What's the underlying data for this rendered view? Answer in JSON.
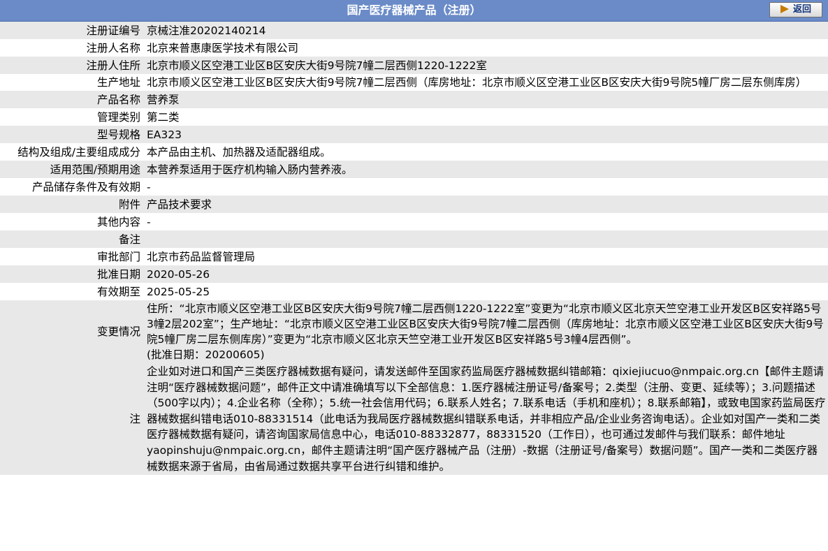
{
  "header": {
    "title": "国产医疗器械产品（注册）",
    "back_label": "返回"
  },
  "rows": [
    {
      "label": "注册证编号",
      "value": "京械注准20202140214"
    },
    {
      "label": "注册人名称",
      "value": "北京来普惠康医学技术有限公司"
    },
    {
      "label": "注册人住所",
      "value": "北京市顺义区空港工业区B区安庆大街9号院7幢二层西侧1220-1222室"
    },
    {
      "label": "生产地址",
      "value": "北京市顺义区空港工业区B区安庆大街9号院7幢二层西侧（库房地址：北京市顺义区空港工业区B区安庆大街9号院5幢厂房二层东侧库房）"
    },
    {
      "label": "产品名称",
      "value": "营养泵"
    },
    {
      "label": "管理类别",
      "value": "第二类"
    },
    {
      "label": "型号规格",
      "value": "EA323"
    },
    {
      "label": "结构及组成/主要组成成分",
      "value": "本产品由主机、加热器及适配器组成。"
    },
    {
      "label": "适用范围/预期用途",
      "value": "本营养泵适用于医疗机构输入肠内营养液。"
    },
    {
      "label": "产品储存条件及有效期",
      "value": "-"
    },
    {
      "label": "附件",
      "value": "产品技术要求"
    },
    {
      "label": "其他内容",
      "value": "-"
    },
    {
      "label": "备注",
      "value": ""
    },
    {
      "label": "审批部门",
      "value": "北京市药品监督管理局"
    },
    {
      "label": "批准日期",
      "value": "2020-05-26"
    },
    {
      "label": "有效期至",
      "value": "2025-05-25"
    }
  ],
  "change": {
    "label": "变更情况",
    "text": "住所：“北京市顺义区空港工业区B区安庆大街9号院7幢二层西侧1220-1222室”变更为“北京市顺义区北京天竺空港工业开发区B区安祥路5号3幢2层202室”；生产地址：“北京市顺义区空港工业区B区安庆大街9号院7幢二层西侧（库房地址：北京市顺义区空港工业区B区安庆大街9号院5幢厂房二层东侧库房）”变更为“北京市顺义区北京天竺空港工业开发区B区安祥路5号3幢4层西侧”。",
    "approval": "(批准日期：20200605)"
  },
  "note": {
    "label": "注",
    "text": "企业如对进口和国产三类医疗器械数据有疑问，请发送邮件至国家药监局医疗器械数据纠错邮箱：qixiejiucuo@nmpaic.org.cn【邮件主题请注明“医疗器械数据问题”，邮件正文中请准确填写以下全部信息：1.医疗器械注册证号/备案号；2.类型（注册、变更、延续等）；3.问题描述（500字以内）；4.企业名称（全称）；5.统一社会信用代码；6.联系人姓名；7.联系电话（手机和座机）；8.联系邮箱】，或致电国家药监局医疗器械数据纠错电话010-88331514（此电话为我局医疗器械数据纠错联系电话，并非相应产品/企业业务咨询电话）。企业如对国产一类和二类医疗器械数据有疑问，请咨询国家局信息中心，电话010-88332877，88331520（工作日），也可通过发邮件与我们联系：邮件地址yaopinshuju@nmpaic.org.cn，邮件主题请注明“国产医疗器械产品（注册）-数据（注册证号/备案号）数据问题”。国产一类和二类医疗器械数据来源于省局，由省局通过数据共享平台进行纠错和维护。"
  }
}
